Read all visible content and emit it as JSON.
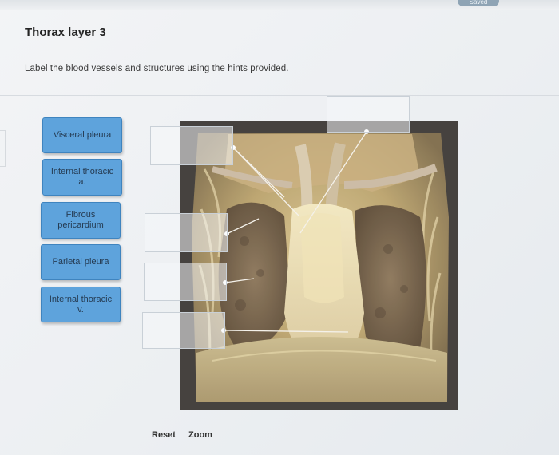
{
  "header": {
    "saved_badge": "Saved",
    "title": "Thorax layer 3",
    "instruction": "Label the blood vessels and structures using the hints provided."
  },
  "labels": [
    {
      "id": "visceral-pleura",
      "text": "Visceral pleura"
    },
    {
      "id": "internal-thoracic-a",
      "text": "Internal thoracic a."
    },
    {
      "id": "fibrous-pericardium",
      "text": "Fibrous pericardium"
    },
    {
      "id": "parietal-pleura",
      "text": "Parietal pleura"
    },
    {
      "id": "internal-thoracic-v",
      "text": "Internal thoracic v."
    }
  ],
  "drop_targets": {
    "count": 6,
    "filled": 0
  },
  "figure": {
    "subject": "dissected thorax specimen, anterior view",
    "palette": {
      "border": "#3e3a38",
      "tissue": "#b9a16a",
      "lung": "#6e5a43",
      "highlight": "#f2e7bf",
      "vessel": "#c9b8a1"
    }
  },
  "controls": {
    "reset_label": "Reset",
    "zoom_label": "Zoom"
  },
  "colors": {
    "chip_fill": "#5ea3dc",
    "chip_border": "#3f84bf",
    "chip_text": "#253b52",
    "page_bg": "#eceff2"
  }
}
